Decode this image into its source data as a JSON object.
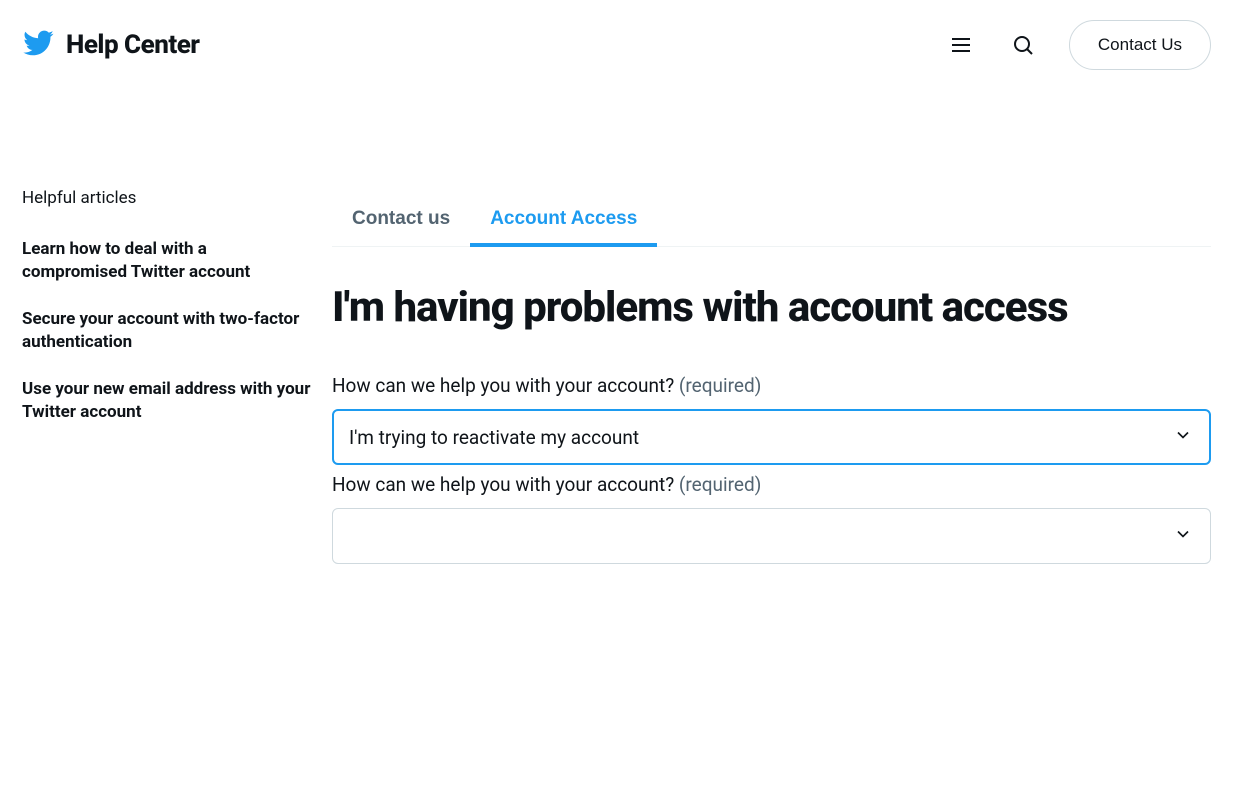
{
  "header": {
    "title": "Help Center",
    "contact_us_label": "Contact Us"
  },
  "sidebar": {
    "title": "Helpful articles",
    "links": [
      "Learn how to deal with a compromised Twitter account",
      "Secure your account with two-factor authentication",
      "Use your new email address with your Twitter account"
    ]
  },
  "tabs": {
    "contact_us": "Contact us",
    "account_access": "Account Access"
  },
  "main": {
    "title": "I'm having problems with account access",
    "form": {
      "q1_label": "How can we help you with your account?",
      "q1_required": "(required)",
      "q1_value": "I'm trying to reactivate my account",
      "q2_label": "How can we help you with your account?",
      "q2_required": "(required)",
      "q2_value": ""
    }
  }
}
